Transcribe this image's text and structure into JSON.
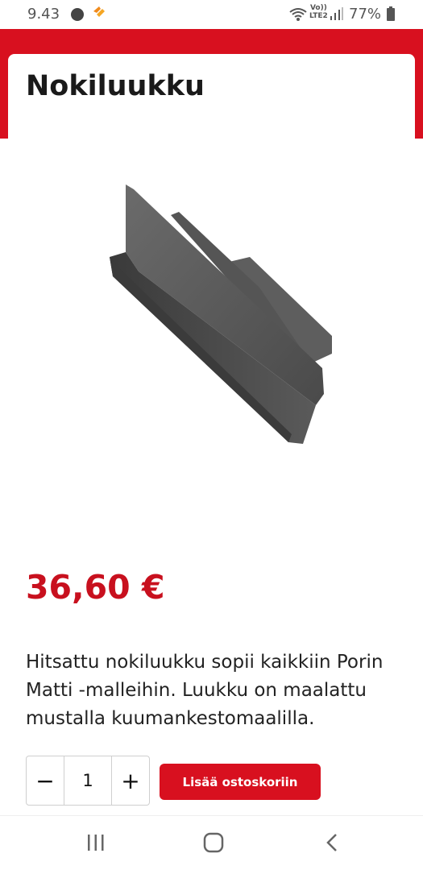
{
  "status_bar": {
    "time": "9.43",
    "network_label_top": "Vo))",
    "network_label_bottom": "LTE2",
    "battery": "77%"
  },
  "product": {
    "title": "Nokiluukku",
    "price": "36,60 €",
    "description": "Hitsattu nokiluukku sopii kaikkiin Porin Matti -malleihin. Luukku on maalattu mustalla kuumankestomaalilla."
  },
  "cart": {
    "decrease_label": "−",
    "quantity": "1",
    "increase_label": "+",
    "add_to_cart_label": "Lisää ostoskoriin"
  },
  "colors": {
    "brand_red": "#d8101f",
    "price_red": "#c8101e"
  },
  "icons": {
    "status": [
      "media-icon",
      "heart-icon",
      "wifi-icon",
      "signal-icon",
      "battery-icon"
    ],
    "nav": [
      "recent-apps-icon",
      "home-icon",
      "back-icon"
    ]
  }
}
